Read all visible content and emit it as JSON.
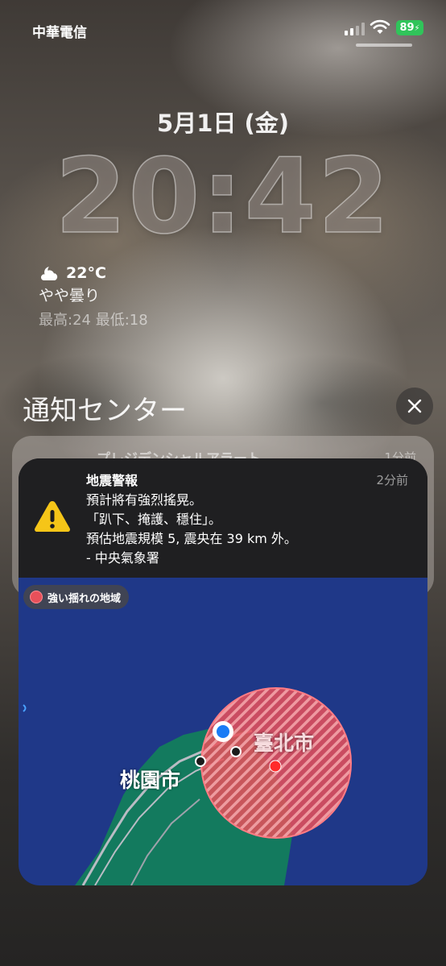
{
  "status_bar": {
    "carrier": "中華電信",
    "battery": "89"
  },
  "lock_screen": {
    "date": "5月1日 (金)",
    "time": "20:42",
    "weather": {
      "temperature": "22°C",
      "condition": "やや曇り",
      "high_low": "最高:24 最低:18",
      "icon": "partly-cloudy-night-icon"
    }
  },
  "notification_center": {
    "title": "通知センター",
    "close_icon": "close-icon"
  },
  "stacked_notification": {
    "title": "プレジデンシャルアラート",
    "time": "1分前"
  },
  "alert": {
    "title": "地震警報",
    "time": "2分前",
    "body_lines": [
      "預計將有強烈搖晃。",
      "「趴下、掩護、穩住」。",
      "預估地震規模 5,  震央在 39 km 外。",
      "- 中央氣象署"
    ],
    "icon": "warning-triangle-icon"
  },
  "map": {
    "legend": "強い揺れの地域",
    "cities": [
      "臺北市",
      "桃園市"
    ],
    "colors": {
      "sea": "#1f3888",
      "land": "#137a5e",
      "shaking_area": "#e8505a"
    }
  }
}
